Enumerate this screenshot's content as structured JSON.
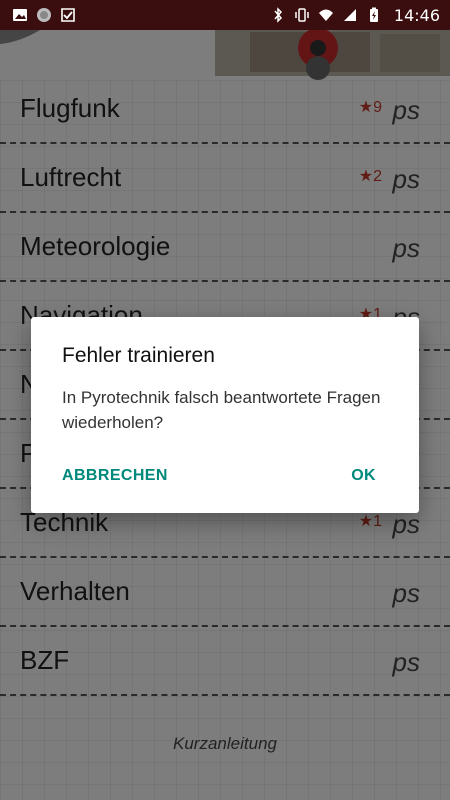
{
  "status_bar": {
    "time": "14:46",
    "left_icons": [
      "image-icon",
      "avatar-icon",
      "download-check-icon"
    ],
    "right_icons": [
      "bluetooth-icon",
      "vibrate-icon",
      "wifi-icon",
      "signal-icon",
      "battery-charging-icon"
    ]
  },
  "subjects": [
    {
      "label": "Flugfunk",
      "badge": "★9",
      "ps": "ps"
    },
    {
      "label": "Luftrecht",
      "badge": "★2",
      "ps": "ps"
    },
    {
      "label": "Meteorologie",
      "badge": "",
      "ps": "ps"
    },
    {
      "label": "Navigation",
      "badge": "★1",
      "ps": "ps"
    },
    {
      "label": "N",
      "badge": "",
      "ps": "ps"
    },
    {
      "label": "P",
      "badge": "",
      "ps": "ps"
    },
    {
      "label": "Technik",
      "badge": "★1",
      "ps": "ps"
    },
    {
      "label": "Verhalten",
      "badge": "",
      "ps": "ps"
    },
    {
      "label": "BZF",
      "badge": "",
      "ps": "ps"
    }
  ],
  "footer": {
    "link": "Kurzanleitung"
  },
  "dialog": {
    "title": "Fehler trainieren",
    "message": "In Pyrotechnik falsch beantwortete Fragen wiederholen?",
    "cancel_label": "ABBRECHEN",
    "ok_label": "OK"
  },
  "colors": {
    "accent": "#00897b",
    "badge": "#c0392b",
    "statusbar": "#3a0e0e"
  }
}
